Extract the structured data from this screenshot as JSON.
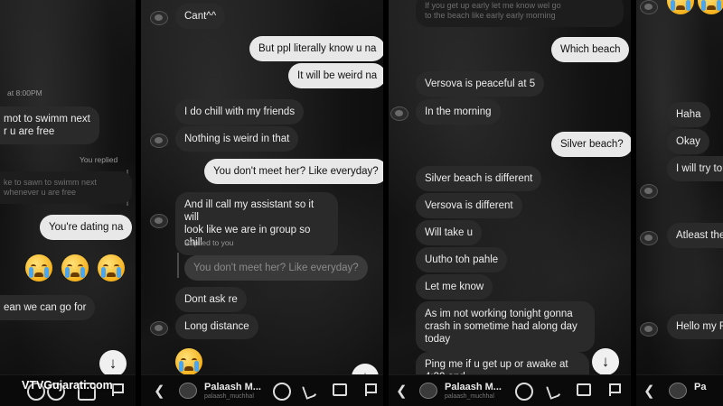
{
  "watermark": "VTVGujarati.com",
  "panel1": {
    "meta_top": "at 8:00PM",
    "msg_a": "mot to swimm next\nr u are free",
    "replied_label": "You replied",
    "quoted_faded": "ke to sawn to swimm next\nwhenever u are free",
    "out_dating": "You're dating na",
    "msg_wean": "ean we can go for"
  },
  "panel2": {
    "msg_cant": "Cant^^",
    "out_ppl": "But ppl literally know u na",
    "out_weird": "It will be weird na",
    "in_chill": "I do chill with my friends",
    "in_nothing": "Nothing is weird in that",
    "out_meet": "You don't meet her? Like everyday?",
    "in_assistant": "And ill call my assistant so it will\nlook like we are in group so chill",
    "replied_label": "Replied to you",
    "quoted": "You don't meet her? Like everyday?",
    "in_dont_ask": "Dont ask re",
    "in_long_distance": "Long distance",
    "bottom_name": "Palaash M...",
    "bottom_handle": "palaash_muchhal"
  },
  "panel3": {
    "top_faded": "If you get up early let me know wel go\nto the beach like early early morning",
    "out_which_beach": "Which beach",
    "in_versova_peaceful": "Versova is peaceful at 5",
    "in_morning": "In the morning",
    "out_silver_q": "Silver beach?",
    "in_silver_diff": "Silver beach is different",
    "in_versova_diff": "Versova is different",
    "in_will_take": "Will take u",
    "in_uutho": "Uutho toh pahle",
    "in_let_me_know": "Let me know",
    "in_not_working": "As im not working tonight gonna\ncrash in sometime had along day\ntoday",
    "in_ping": "Ping me if u get up or awake at\n4:30 and ..",
    "bottom_name": "Palaash M...",
    "bottom_handle": "palaash_muchhal"
  },
  "panel4": {
    "in_haha": "Haha",
    "in_okay": "Okay",
    "in_will_try": "I will try to",
    "in_atleast": "Atleast the",
    "in_hello": "Hello my R"
  },
  "icons": {
    "back": "chevron-left-icon",
    "scroll_down": "arrow-down-icon"
  }
}
